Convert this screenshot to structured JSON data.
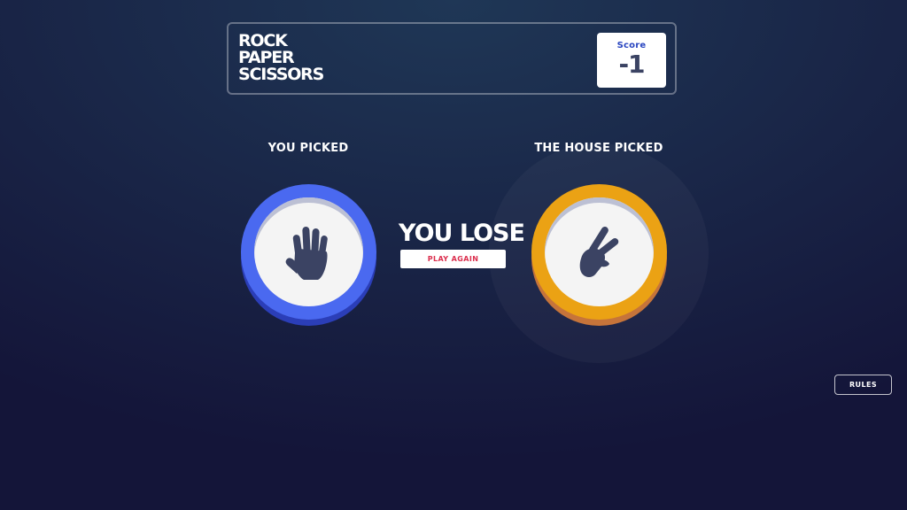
{
  "header": {
    "logo_lines": [
      "ROCK",
      "PAPER",
      "SCISSORS"
    ],
    "score_label": "Score",
    "score_value": "-1"
  },
  "player": {
    "label": "YOU PICKED",
    "choice_icon": "hand-paper-icon",
    "ring_color": "#4a69f0"
  },
  "house": {
    "label": "THE HOUSE PICKED",
    "choice_icon": "hand-scissors-icon",
    "ring_color": "#eba214"
  },
  "result": {
    "text": "YOU LOSE",
    "play_again_label": "PLAY AGAIN"
  },
  "rules_label": "RULES",
  "colors": {
    "icon_dark": "#3b4363",
    "play_again_text": "#db2e4d",
    "score_label": "#2a46c0"
  }
}
